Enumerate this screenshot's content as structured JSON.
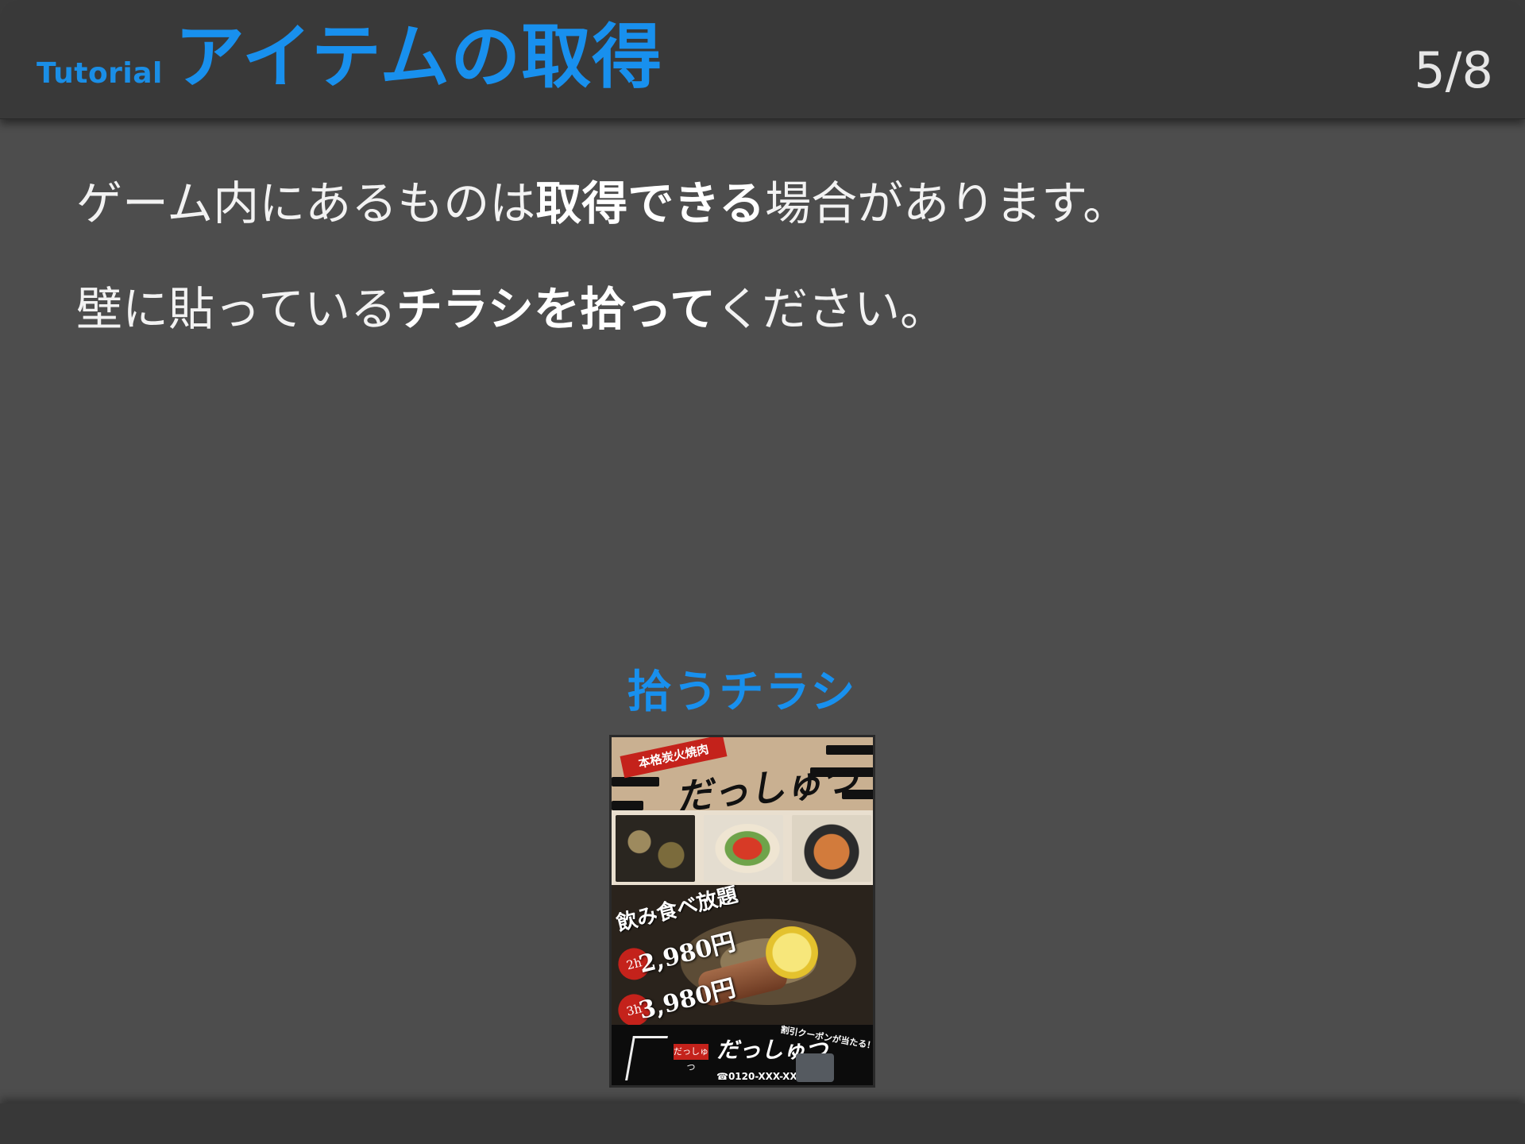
{
  "header": {
    "tutorial_label": "Tutorial",
    "title": "アイテムの取得",
    "page_counter": "5/8"
  },
  "instructions": {
    "line1": {
      "before": "ゲーム内にあるものは",
      "emphasis": "取得できる",
      "after": "場合があります。"
    },
    "line2": {
      "before": "壁に貼っている",
      "emphasis": "チラシを拾って",
      "after": "ください。"
    }
  },
  "flyer": {
    "caption": "拾うチラシ",
    "ribbon": "本格炭火焼肉",
    "brand": "だっしゅつ",
    "tabehodai": "飲み食べ放題",
    "plans": [
      {
        "hours": "2h",
        "price": "2,980円"
      },
      {
        "hours": "3h",
        "price": "3,980円"
      }
    ],
    "mini_logo": "だっしゅつ",
    "brand_small": "だっしゅつ",
    "phone": "☎0120-XXX-XXX",
    "coupon": "割引クーポンが当たる！"
  },
  "colors": {
    "accent": "#1890ee",
    "background": "#4d4d4d",
    "header_bg": "#393939",
    "flyer_red": "#c4221b"
  }
}
